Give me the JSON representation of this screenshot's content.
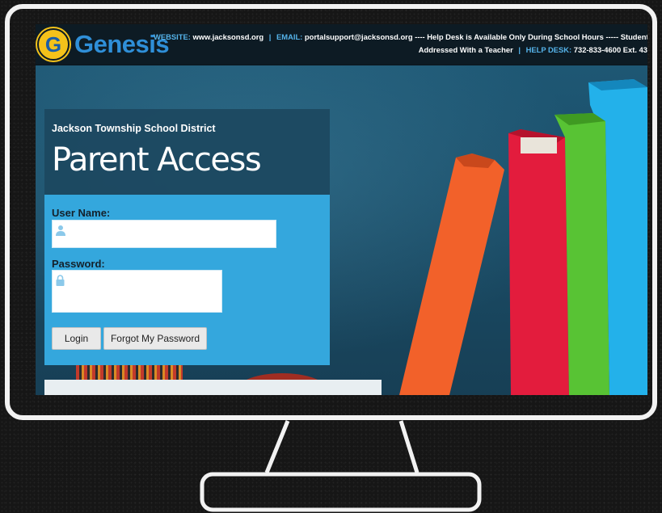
{
  "header": {
    "logo_letter": "G",
    "logo_text": "Genesis",
    "website_label": "WEBSITE:",
    "website": "www.jacksonsd.org",
    "email_label": "EMAIL:",
    "email": "portalsupport@jacksonsd.org",
    "notice_line1": "---- Help Desk is Available Only During School Hours ----- Student Portal Issues Should B",
    "notice_line2": "Addressed With a Teacher",
    "helpdesk_label": "HELP DESK:",
    "helpdesk": "732-833-4600 Ext. 43"
  },
  "login": {
    "district": "Jackson Township School District",
    "title": "Parent Access",
    "username_label": "User Name:",
    "password_label": "Password:",
    "login_button": "Login",
    "forgot_button": "Forgot My Password"
  },
  "colors": {
    "accent": "#34a7dd",
    "panel_dark": "#1c4860",
    "logo_yellow": "#f4c21a",
    "logo_blue": "#2f8fd8",
    "book_orange": "#f2612a",
    "book_red": "#e31c3d",
    "book_green": "#58c334",
    "book_cyan": "#23b1ea"
  }
}
